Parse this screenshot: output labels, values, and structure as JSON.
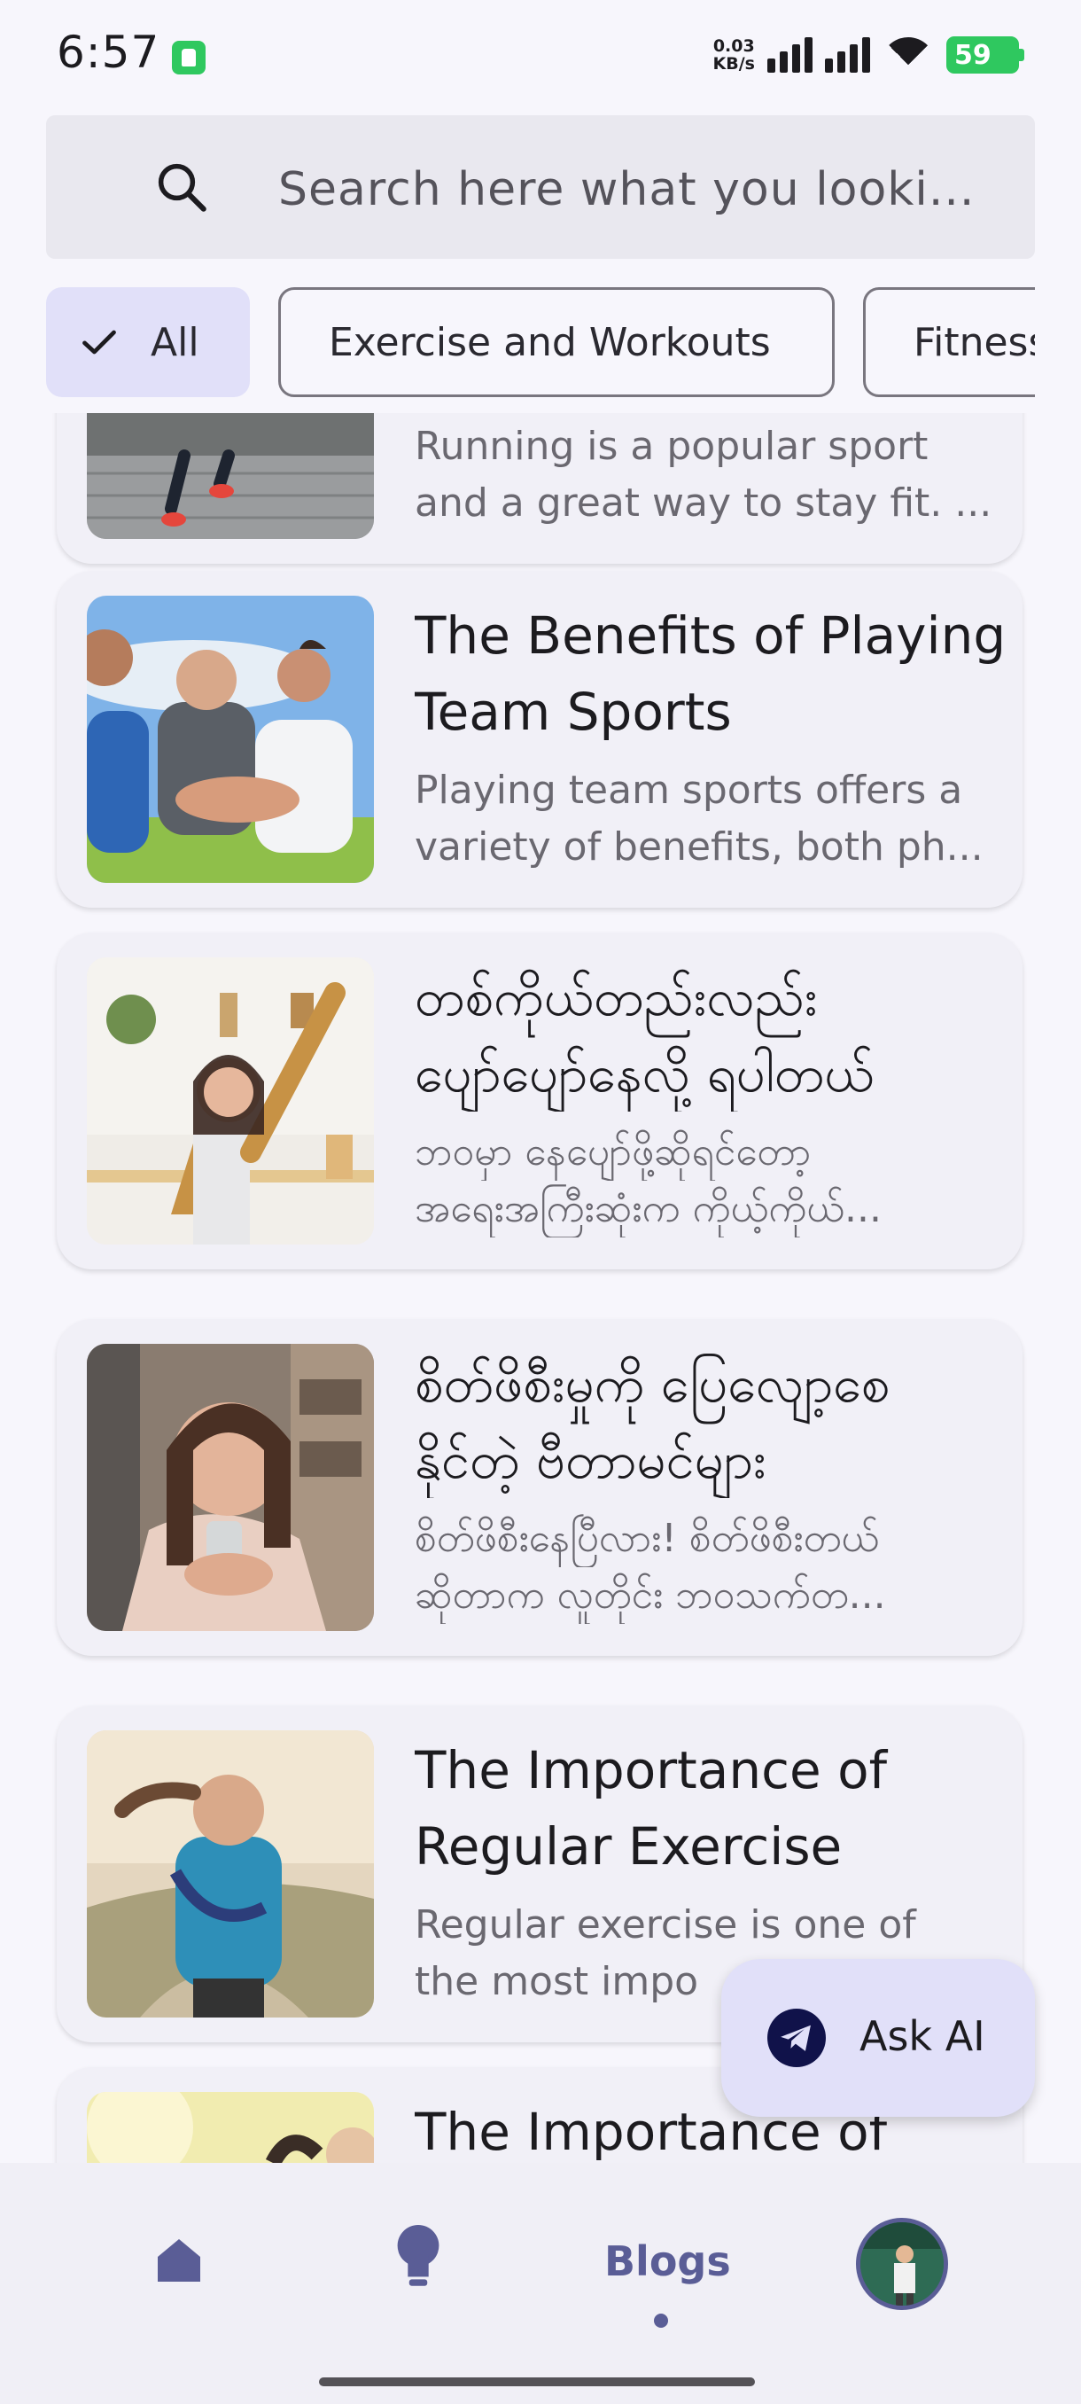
{
  "status_bar": {
    "time": "6:57",
    "net_speed_value": "0.03",
    "net_speed_unit": "KB/s",
    "battery_level": "59",
    "icons": [
      "app-notification-icon",
      "signal-icon",
      "wifi-icon",
      "battery-charging-icon"
    ]
  },
  "search": {
    "placeholder": "Search here what you looki...",
    "icon": "search-icon"
  },
  "chips": [
    {
      "label": "All",
      "selected": true
    },
    {
      "label": "Exercise and Workouts",
      "selected": false
    },
    {
      "label": "Fitness",
      "selected": false
    }
  ],
  "cards": [
    {
      "title_lines": [],
      "desc_lines": [
        "Running is a popular sport",
        "and a great way to stay fit. ..."
      ]
    },
    {
      "title_lines": [
        "The Benefits of Playing",
        "Team Sports"
      ],
      "desc_lines": [
        "Playing team sports offers a",
        "variety of benefits, both ph..."
      ]
    },
    {
      "title_lines": [
        "တစ်ကိုယ်တည်းလည်း",
        "ပျော်ပျော်နေလို့ ရပါတယ်"
      ],
      "desc_lines": [
        "ဘဝမှာ နေပျော်ဖို့ဆိုရင်တော့",
        "အရေးအကြီးဆုံးက ကိုယ့်ကိုယ်..."
      ]
    },
    {
      "title_lines": [
        "စိတ်ဖိစီးမှုကို ပြေလျော့စေ",
        "နိုင်တဲ့ ဗီတာမင်များ"
      ],
      "desc_lines": [
        "စိတ်ဖိစီးနေပြီလား! စိတ်ဖိစီးတယ်",
        "ဆိုတာက လူတိုင်း ဘဝသက်တ..."
      ]
    },
    {
      "title_lines": [
        "The Importance of",
        "Regular Exercise"
      ],
      "desc_lines": [
        "Regular exercise is one of",
        "the most impo"
      ]
    },
    {
      "title_lines": [
        "The Importance of"
      ],
      "desc_lines": []
    }
  ],
  "fab": {
    "label": "Ask AI",
    "icon": "telegram-send-icon"
  },
  "bottom_nav": {
    "active_label": "Blogs",
    "items": [
      "home-icon",
      "lightbulb-icon",
      "Blogs",
      "profile-avatar"
    ]
  },
  "colors": {
    "background": "#f7f6fc",
    "accent": "#5a5d96",
    "chip_selected": "#e1e0f9",
    "card": "#f1f0f7",
    "battery": "#2fc85f"
  }
}
